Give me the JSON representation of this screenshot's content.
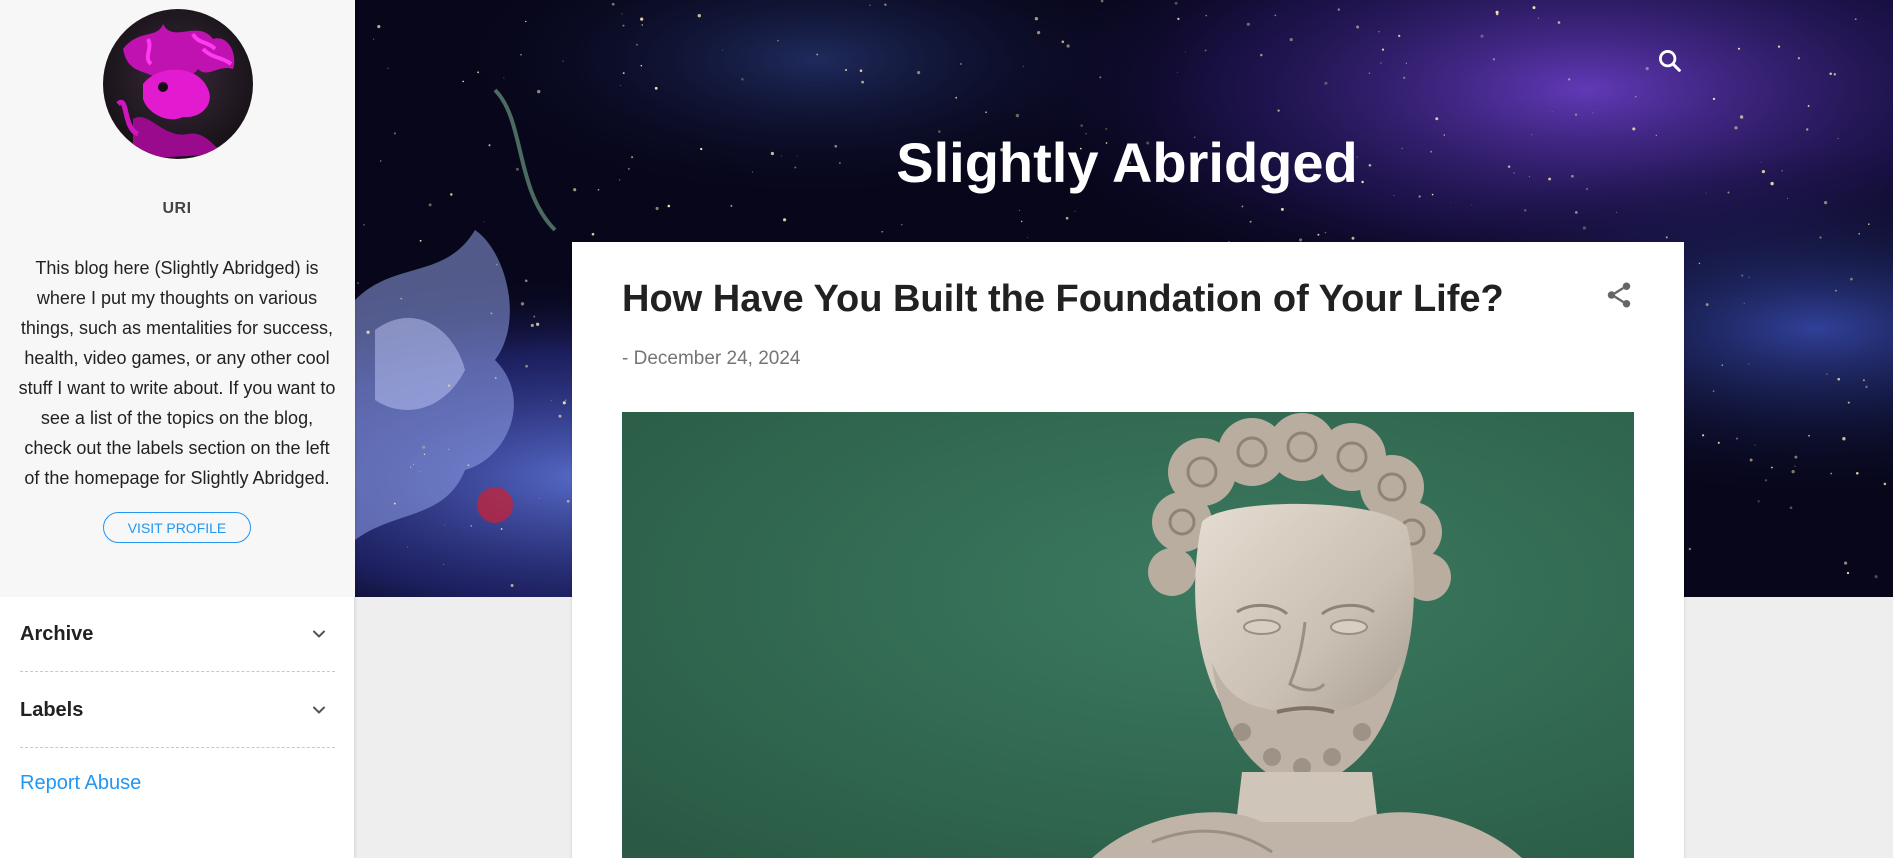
{
  "blog": {
    "title": "Slightly Abridged"
  },
  "profile": {
    "name": "URI",
    "description": "This blog here (Slightly Abridged) is where I put my thoughts on various things, such as mentalities for success, health, video games, or any other cool stuff I want to write about. If you want to see a list of the topics on the blog, check out the labels section on the left of the homepage for Slightly Abridged.",
    "visit_label": "VISIT PROFILE"
  },
  "sidebar": {
    "widgets": [
      {
        "title": "Archive",
        "icon": "chevron-down-icon"
      },
      {
        "title": "Labels",
        "icon": "chevron-down-icon"
      }
    ],
    "report_label": "Report Abuse"
  },
  "header": {
    "search_icon": "search-icon"
  },
  "post": {
    "title": "How Have You Built the Foundation of Your Life?",
    "date": "- December 24, 2024",
    "share_icon": "share-icon",
    "image": "marble-bust-on-green-background"
  },
  "colors": {
    "accent": "#2196f3",
    "sidebar_bg": "#f7f7f7",
    "page_bg": "#eeeeee",
    "title_text": "#212121",
    "image_bg": "#2f6850"
  }
}
